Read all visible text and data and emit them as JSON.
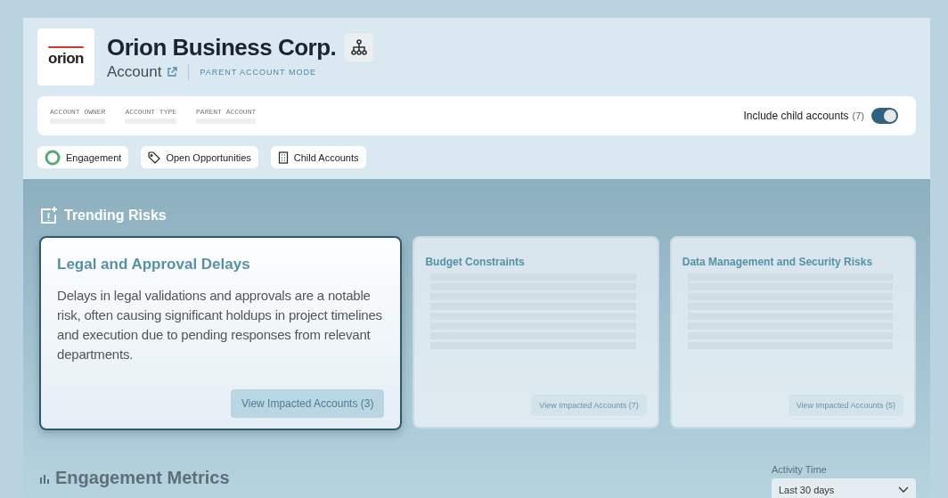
{
  "account": {
    "logo": "orion",
    "name": "Orion Business Corp.",
    "type": "Account",
    "mode": "PARENT ACCOUNT MODE"
  },
  "fields": [
    {
      "label": "ACCOUNT OWNER"
    },
    {
      "label": "ACCOUNT TYPE"
    },
    {
      "label": "PARENT ACCOUNT"
    }
  ],
  "include_child": {
    "label": "Include child accounts",
    "count": "(7)",
    "on": true
  },
  "chips": [
    {
      "kind": "ring",
      "label": "Engagement"
    },
    {
      "kind": "tag",
      "label": "Open Opportunities"
    },
    {
      "kind": "building",
      "label": "Child Accounts"
    }
  ],
  "trending": {
    "title": "Trending Risks",
    "risks": [
      {
        "title": "Legal and Approval Delays",
        "selected": true,
        "text": "Delays in legal validations and approvals are a notable risk, often causing significant holdups in project timelines and execution due to pending responses from relevant departments.",
        "button": "View Impacted Accounts",
        "count": "(3)"
      },
      {
        "title": "Budget Constraints",
        "selected": false,
        "button": "View Impacted Accounts",
        "count": "(7)"
      },
      {
        "title": "Data Management and Security Risks",
        "selected": false,
        "button": "View Impacted Accounts",
        "count": "(5)"
      }
    ]
  },
  "metrics": {
    "title": "Engagement Metrics",
    "filter_label": "Activity Time",
    "filter_value": "Last 30 days"
  }
}
